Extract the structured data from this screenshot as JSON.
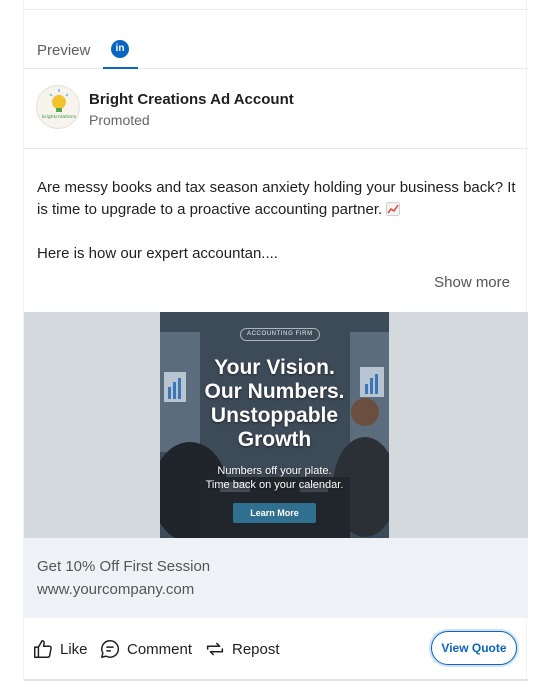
{
  "tabs": {
    "preview_label": "Preview",
    "linkedin_icon": "in"
  },
  "account": {
    "name": "Bright Creations Ad Account",
    "status": "Promoted",
    "logo_text": "brightcreations"
  },
  "post": {
    "paragraph1": "Are messy books and tax season anxiety holding your business back? It is time to upgrade to a proactive accounting partner.",
    "paragraph1_emoji": "chart-increasing-icon",
    "paragraph2": "Here is how our expert accountan....",
    "show_more": "Show more"
  },
  "creative": {
    "tag": "ACCOUNTING FIRM",
    "headline_line1": "Your Vision.",
    "headline_line2": "Our Numbers.",
    "headline_line3": "Unstoppable",
    "headline_line4": "Growth",
    "subline1": "Numbers off your plate.",
    "subline2": "Time back on your calendar.",
    "cta": "Learn More"
  },
  "info": {
    "offer": "Get 10% Off First Session",
    "url": "www.yourcompany.com"
  },
  "actions": {
    "like": "Like",
    "comment": "Comment",
    "repost": "Repost",
    "view_quote": "View Quote"
  },
  "colors": {
    "linkedin_blue": "#0a66c2",
    "creative_bg": "#d4d9de",
    "info_bg": "#eef2f6"
  }
}
